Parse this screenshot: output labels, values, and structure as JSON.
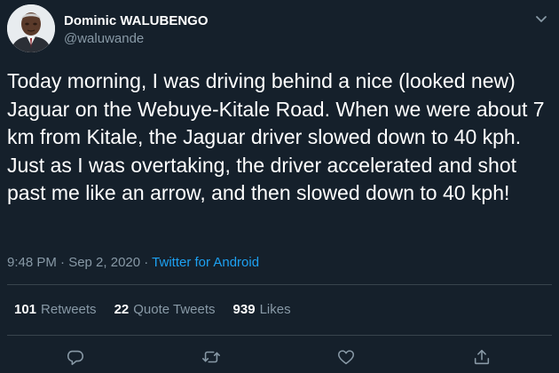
{
  "author": {
    "name": "Dominic WALUBENGO",
    "handle": "@waluwande"
  },
  "tweet": {
    "text": "Today morning, I was driving behind a nice (looked new) Jaguar on the Webuye-Kitale Road. When we were about 7 km from Kitale, the Jaguar driver slowed down to 40 kph. Just as I was overtaking, the driver accelerated and shot past me like an arrow, and then slowed down to 40 kph!",
    "time": "9:48 PM · Sep 2, 2020",
    "separator": " · ",
    "source": "Twitter for Android"
  },
  "stats": {
    "retweets_count": "101",
    "retweets_label": "Retweets",
    "quotes_count": "22",
    "quotes_label": "Quote Tweets",
    "likes_count": "939",
    "likes_label": "Likes"
  },
  "icons": {
    "menu": "chevron-down-icon",
    "reply": "reply-icon",
    "retweet": "retweet-icon",
    "like": "heart-icon",
    "share": "share-icon"
  },
  "colors": {
    "background": "#15202b",
    "text": "#ffffff",
    "secondary": "#8899a6",
    "accent": "#1da1f2",
    "divider": "#38444d"
  }
}
